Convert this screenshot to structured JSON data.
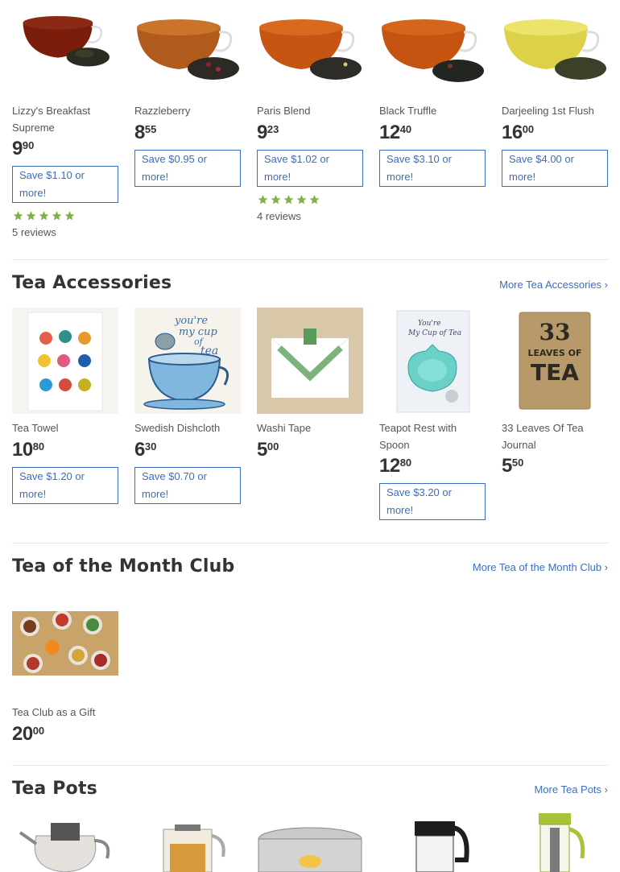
{
  "featured_teas": [
    {
      "name": "Lizzy's Breakfast Supreme",
      "price_whole": "9",
      "price_cents": "90",
      "save": "Save $1.10 or more!",
      "rating": 5,
      "reviews": "5 reviews"
    },
    {
      "name": "Razzleberry",
      "price_whole": "8",
      "price_cents": "55",
      "save": "Save $0.95 or more!"
    },
    {
      "name": "Paris Blend",
      "price_whole": "9",
      "price_cents": "23",
      "save": "Save $1.02 or more!",
      "rating": 5,
      "reviews": "4 reviews"
    },
    {
      "name": "Black Truffle",
      "price_whole": "12",
      "price_cents": "40",
      "save": "Save $3.10 or more!"
    },
    {
      "name": "Darjeeling 1st Flush",
      "price_whole": "16",
      "price_cents": "00",
      "save": "Save $4.00 or more!"
    }
  ],
  "accessories": {
    "title": "Tea Accessories",
    "more_link": "More Tea Accessories ›",
    "items": [
      {
        "name": "Tea Towel",
        "price_whole": "10",
        "price_cents": "80",
        "save": "Save $1.20 or more!"
      },
      {
        "name": "Swedish Dishcloth",
        "price_whole": "6",
        "price_cents": "30",
        "save": "Save $0.70 or more!"
      },
      {
        "name": "Washi Tape",
        "price_whole": "5",
        "price_cents": "00"
      },
      {
        "name": "Teapot Rest with Spoon",
        "price_whole": "12",
        "price_cents": "80",
        "save": "Save $3.20 or more!"
      },
      {
        "name": "33 Leaves Of Tea Journal",
        "price_whole": "5",
        "price_cents": "50"
      }
    ]
  },
  "club": {
    "title": "Tea of the Month Club",
    "more_link": "More Tea of the Month Club ›",
    "items": [
      {
        "name": "Tea Club as a Gift",
        "price_whole": "20",
        "price_cents": "00"
      }
    ]
  },
  "teapots": {
    "title": "Tea Pots",
    "more_link": "More Tea Pots ›"
  },
  "image_text": {
    "cup_line1": "you're",
    "cup_line2": "my cup",
    "cup_line3": "of",
    "cup_line4": "tea",
    "rest_line1": "You're",
    "rest_line2": "My Cup of Tea",
    "journal_line1": "33",
    "journal_line2": "LEAVES OF",
    "journal_line3": "TEA"
  },
  "colors": {
    "accent": "#3b6ec0",
    "star": "#7cb342",
    "text": "#333333"
  }
}
